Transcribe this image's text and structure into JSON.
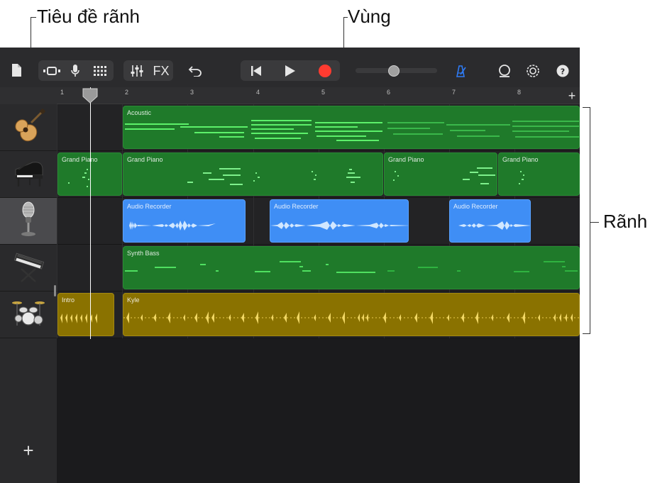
{
  "callouts": {
    "track_header": "Tiêu đề rãnh",
    "region": "Vùng",
    "tracks": "Rãnh"
  },
  "toolbar": {
    "fx_label": "FX",
    "icons": [
      "document-icon",
      "view-toggle-icon",
      "microphone-icon",
      "grid-icon",
      "mixer-icon",
      "undo-icon",
      "rewind-icon",
      "play-icon",
      "record-icon",
      "volume-slider",
      "metronome-icon",
      "loop-icon",
      "settings-icon",
      "help-icon"
    ],
    "record_color": "#ff3b30",
    "metronome_color": "#2f7cf6"
  },
  "ruler": {
    "bars": [
      "1",
      "2",
      "3",
      "4",
      "5",
      "6",
      "7",
      "8"
    ],
    "add_label": "+"
  },
  "sidebar": {
    "tracks": [
      "acoustic-guitar-icon",
      "grand-piano-icon",
      "microphone-icon",
      "synth-keyboard-icon",
      "drum-kit-icon"
    ],
    "selected_track_index": 2,
    "add_label": "+"
  },
  "regions": {
    "acoustic": "Acoustic",
    "piano_1": "Grand Piano",
    "piano_2": "Grand Piano",
    "piano_3": "Grand Piano",
    "piano_4": "Grand Piano",
    "audio_1": "Audio Recorder",
    "audio_2": "Audio Recorder",
    "audio_3": "Audio Recorder",
    "synth_bass": "Synth Bass",
    "intro": "Intro",
    "kyle": "Kyle"
  },
  "colors": {
    "midi_region": "#1f7a2a",
    "audio_region": "#3f8ef5",
    "drummer_region": "#8a7200"
  }
}
